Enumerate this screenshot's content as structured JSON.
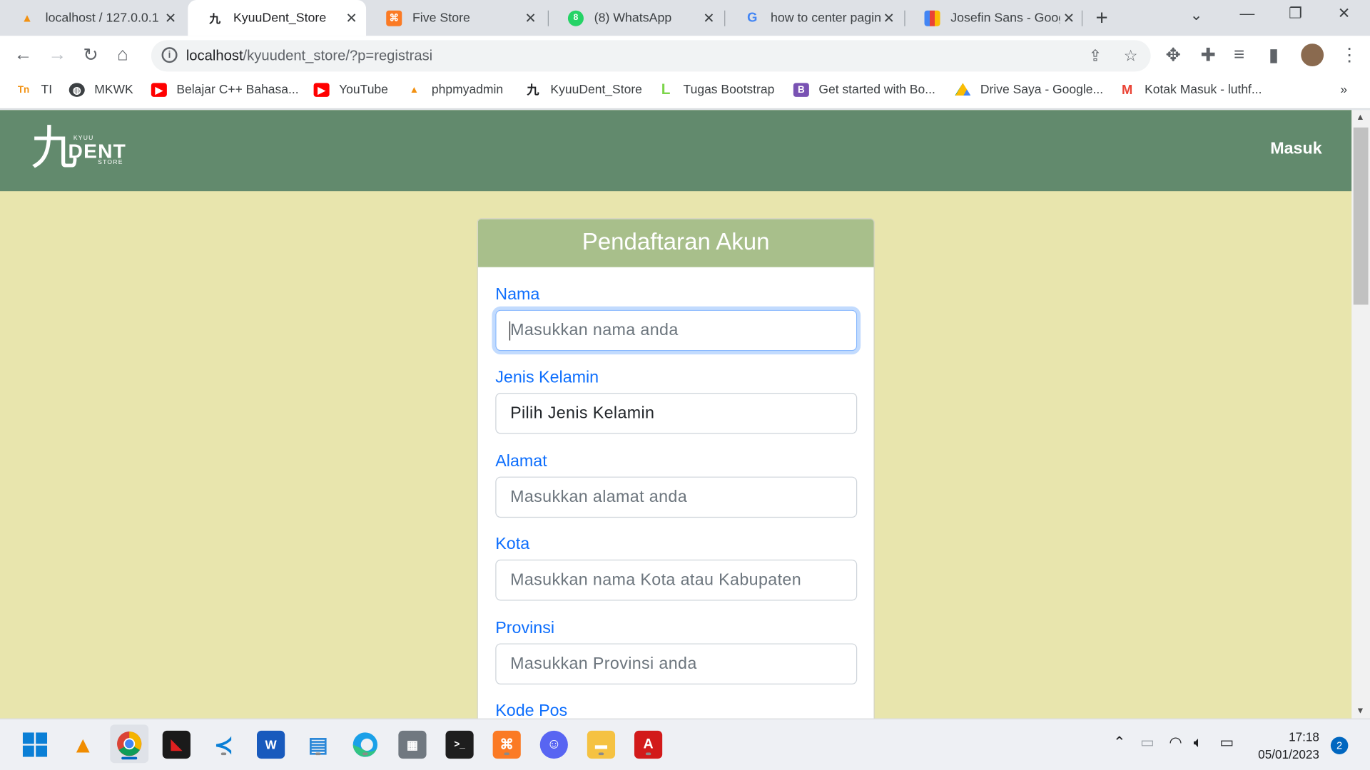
{
  "browser": {
    "tabs": [
      {
        "title": "localhost / 127.0.0.1",
        "icon": "phpmyadmin-icon"
      },
      {
        "title": "KyuuDent_Store",
        "icon": "kyuudent-icon"
      },
      {
        "title": "Five Store",
        "icon": "xampp-icon"
      },
      {
        "title": "(8) WhatsApp",
        "icon": "whatsapp-icon"
      },
      {
        "title": "how to center pagin",
        "icon": "google-icon"
      },
      {
        "title": "Josefin Sans - Goog",
        "icon": "google-fonts-icon"
      }
    ],
    "url_host": "localhost",
    "url_path": "/kyuudent_store/?p=registrasi",
    "bookmarks": [
      "TI",
      "MKWK",
      "Belajar C++ Bahasa...",
      "YouTube",
      "phpmyadmin",
      "KyuuDent_Store",
      "Tugas Bootstrap",
      "Get started with Bo...",
      "Drive Saya - Google...",
      "Kotak Masuk - luthf..."
    ]
  },
  "site": {
    "logo": {
      "kanji": "九",
      "kyuu": "KYUU",
      "dent": "DENT",
      "store": "STORE"
    },
    "nav_login": "Masuk"
  },
  "form": {
    "title": "Pendaftaran Akun",
    "fields": [
      {
        "label": "Nama",
        "placeholder": "Masukkan nama anda"
      },
      {
        "label": "Jenis Kelamin",
        "placeholder": "Pilih Jenis Kelamin"
      },
      {
        "label": "Alamat",
        "placeholder": "Masukkan alamat anda"
      },
      {
        "label": "Kota",
        "placeholder": "Masukkan nama Kota atau Kabupaten"
      },
      {
        "label": "Provinsi",
        "placeholder": "Masukkan Provinsi anda"
      },
      {
        "label": "Kode Pos",
        "placeholder": ""
      }
    ]
  },
  "colors": {
    "navbar": "#628a6d",
    "page_bg": "#e8e5ad",
    "card_header": "#a8bf8b",
    "label": "#0d6efd"
  },
  "taskbar": {
    "time": "17:18",
    "date": "05/01/2023",
    "notifications": "2"
  }
}
